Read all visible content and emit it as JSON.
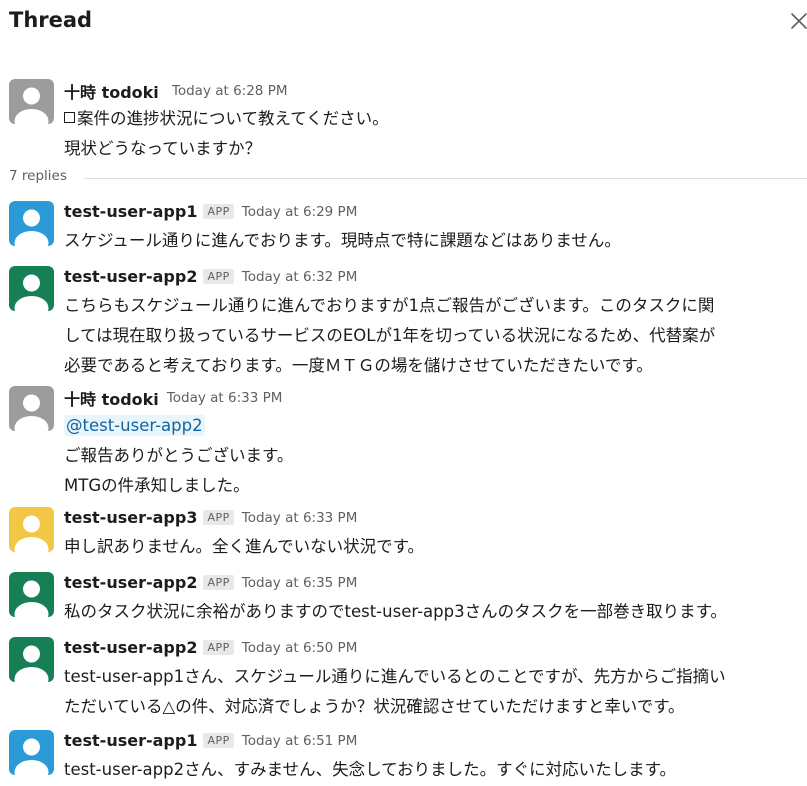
{
  "header": {
    "title": "Thread",
    "close_icon": "close-icon"
  },
  "parent": {
    "sender": "十時 todoki",
    "timestamp": "Today at 6:28 PM",
    "avatar_color": "#9c9c9c",
    "lines": [
      "案件の進捗状況について教えてください。",
      "現状どうなっていますか？"
    ]
  },
  "replies_label": "7 replies",
  "replies": [
    {
      "sender": "test-user-app1",
      "badge": "APP",
      "timestamp": "Today at 6:29 PM",
      "avatar_color": "#2a9bd6",
      "lines": [
        "スケジュール通りに進んでおります。現時点で特に課題などはありません。"
      ]
    },
    {
      "sender": "test-user-app2",
      "badge": "APP",
      "timestamp": "Today at 6:32 PM",
      "avatar_color": "#168054",
      "lines": [
        "こちらもスケジュール通りに進んでおりますが1点ご報告がございます。このタスクに関",
        "しては現在取り扱っているサービスのEOLが1年を切っている状況になるため、代替案が",
        "必要であると考えております。一度ＭＴＧの場を儲けさせていただきたいです。"
      ]
    },
    {
      "sender": "十時 todoki",
      "badge": "",
      "timestamp": "Today at 6:33 PM",
      "avatar_color": "#9c9c9c",
      "mention": "@test-user-app2",
      "lines": [
        "ご報告ありがとうございます。",
        "MTGの件承知しました。"
      ]
    },
    {
      "sender": "test-user-app3",
      "badge": "APP",
      "timestamp": "Today at 6:33 PM",
      "avatar_color": "#f2c744",
      "lines": [
        "申し訳ありません。全く進んでいない状況です。"
      ]
    },
    {
      "sender": "test-user-app2",
      "badge": "APP",
      "timestamp": "Today at 6:35 PM",
      "avatar_color": "#168054",
      "lines": [
        "私のタスク状況に余裕がありますのでtest-user-app3さんのタスクを一部巻き取ります。"
      ]
    },
    {
      "sender": "test-user-app2",
      "badge": "APP",
      "timestamp": "Today at 6:50 PM",
      "avatar_color": "#168054",
      "lines": [
        "test-user-app1さん、スケジュール通りに進んでいるとのことですが、先方からご指摘い",
        "ただいている△の件、対応済でしょうか？状況確認させていただけますと幸いです。"
      ]
    },
    {
      "sender": "test-user-app1",
      "badge": "APP",
      "timestamp": "Today at 6:51 PM",
      "avatar_color": "#2a9bd6",
      "lines": [
        "test-user-app2さん、すみません、失念しておりました。すぐに対応いたします。"
      ]
    }
  ]
}
